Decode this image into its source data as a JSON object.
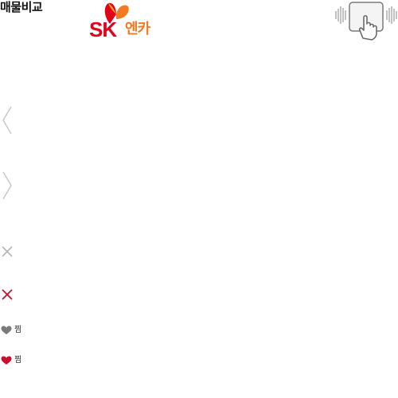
{
  "header": {
    "title": "매물비교"
  },
  "logo": {
    "brand_text": "SK",
    "sub_text": "엔카",
    "brand_color": "#e2001a",
    "sub_color": "#f47920",
    "icon": "sk-butterfly-logo"
  },
  "swipe_hint": {
    "icon": "swipe-gesture-icon"
  },
  "navigation": {
    "prev_icon": "chevron-left-icon",
    "next_icon": "chevron-right-icon",
    "arrow_color": "#c8c8c8"
  },
  "remove_buttons": [
    {
      "icon": "close-icon",
      "color": "#b5b5b5"
    },
    {
      "icon": "close-icon",
      "color": "#c8102e"
    }
  ],
  "favorites": [
    {
      "icon": "heart-icon",
      "label": "찜",
      "color": "#7a7a7a"
    },
    {
      "icon": "heart-icon",
      "label": "찜",
      "color": "#c8102e"
    }
  ]
}
